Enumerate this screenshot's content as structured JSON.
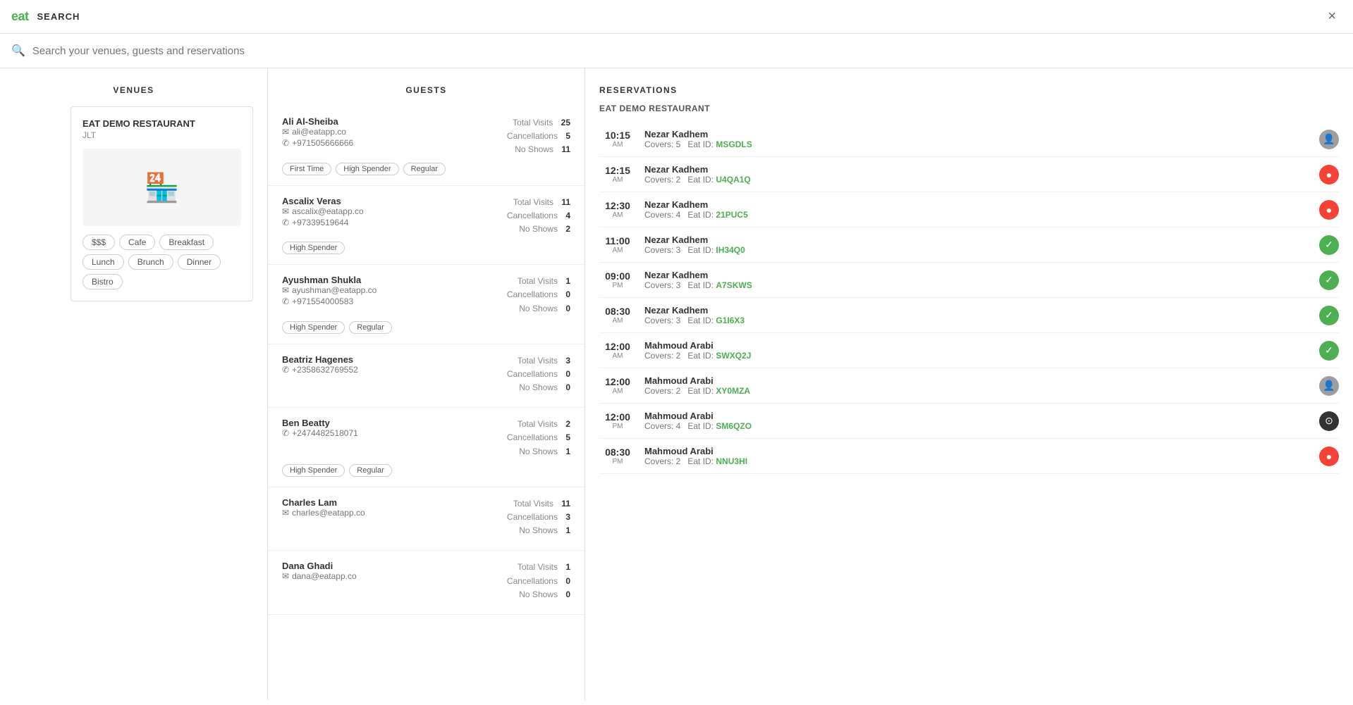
{
  "header": {
    "logo": "eat",
    "title": "SEARCH",
    "close_label": "×"
  },
  "search": {
    "placeholder": "Search your venues, guests and reservations"
  },
  "venues": {
    "section_title": "VENUES",
    "venue": {
      "name": "EAT DEMO RESTAURANT",
      "location": "JLT",
      "tags": [
        "$$$",
        "Cafe",
        "Breakfast",
        "Lunch",
        "Brunch",
        "Dinner",
        "Bistro"
      ]
    }
  },
  "guests": {
    "section_title": "GUESTS",
    "items": [
      {
        "name": "Ali Al-Sheiba",
        "email": "ali@eatapp.co",
        "phone": "+971505666666",
        "total_visits": 25,
        "cancellations": 5,
        "no_shows": 11,
        "tags": [
          "First Time",
          "High Spender",
          "Regular"
        ]
      },
      {
        "name": "Ascalix Veras",
        "email": "ascalix@eatapp.co",
        "phone": "+97339519644",
        "total_visits": 11,
        "cancellations": 4,
        "no_shows": 2,
        "tags": [
          "High Spender"
        ]
      },
      {
        "name": "Ayushman Shukla",
        "email": "ayushman@eatapp.co",
        "phone": "+971554000583",
        "total_visits": 1,
        "cancellations": 0,
        "no_shows": 0,
        "tags": [
          "High Spender",
          "Regular"
        ]
      },
      {
        "name": "Beatriz Hagenes",
        "email": "",
        "phone": "+2358632769552",
        "total_visits": 3,
        "cancellations": 0,
        "no_shows": 0,
        "tags": []
      },
      {
        "name": "Ben Beatty",
        "email": "",
        "phone": "+2474482518071",
        "total_visits": 2,
        "cancellations": 5,
        "no_shows": 1,
        "tags": [
          "High Spender",
          "Regular"
        ]
      },
      {
        "name": "Charles Lam",
        "email": "charles@eatapp.co",
        "phone": "",
        "total_visits": 11,
        "cancellations": 3,
        "no_shows": 1,
        "tags": []
      },
      {
        "name": "Dana Ghadi",
        "email": "dana@eatapp.co",
        "phone": "",
        "total_visits": 1,
        "cancellations": 0,
        "no_shows": 0,
        "tags": []
      }
    ]
  },
  "reservations": {
    "section_title": "RESERVATIONS",
    "venue_title": "EAT DEMO RESTAURANT",
    "items": [
      {
        "time": "10:15",
        "ampm": "AM",
        "name": "Nezar Kadhem",
        "covers": 5,
        "eat_id": "MSGDLS",
        "status": "neutral"
      },
      {
        "time": "12:15",
        "ampm": "AM",
        "name": "Nezar Kadhem",
        "covers": 2,
        "eat_id": "U4QA1Q",
        "status": "cancelled"
      },
      {
        "time": "12:30",
        "ampm": "AM",
        "name": "Nezar Kadhem",
        "covers": 4,
        "eat_id": "21PUC5",
        "status": "cancelled"
      },
      {
        "time": "11:00",
        "ampm": "AM",
        "name": "Nezar Kadhem",
        "covers": 3,
        "eat_id": "IH34Q0",
        "status": "confirmed"
      },
      {
        "time": "09:00",
        "ampm": "PM",
        "name": "Nezar Kadhem",
        "covers": 3,
        "eat_id": "A7SKWS",
        "status": "confirmed"
      },
      {
        "time": "08:30",
        "ampm": "AM",
        "name": "Nezar Kadhem",
        "covers": 3,
        "eat_id": "G1I6X3",
        "status": "confirmed"
      },
      {
        "time": "12:00",
        "ampm": "AM",
        "name": "Mahmoud Arabi",
        "covers": 2,
        "eat_id": "SWXQ2J",
        "status": "confirmed"
      },
      {
        "time": "12:00",
        "ampm": "AM",
        "name": "Mahmoud Arabi",
        "covers": 2,
        "eat_id": "XY0MZA",
        "status": "neutral"
      },
      {
        "time": "12:00",
        "ampm": "PM",
        "name": "Mahmoud Arabi",
        "covers": 4,
        "eat_id": "SM6QZO",
        "status": "dark"
      },
      {
        "time": "08:30",
        "ampm": "PM",
        "name": "Mahmoud Arabi",
        "covers": 2,
        "eat_id": "NNU3HI",
        "status": "cancelled"
      }
    ]
  },
  "labels": {
    "total_visits": "Total Visits",
    "cancellations": "Cancellations",
    "no_shows": "No Shows",
    "covers": "Covers:",
    "eat_id_label": "Eat ID:"
  }
}
